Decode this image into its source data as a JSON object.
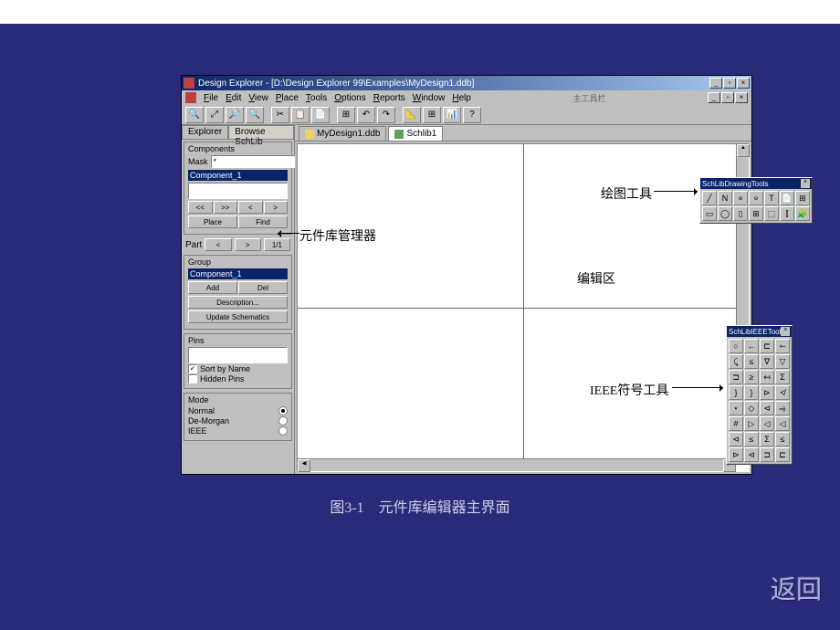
{
  "window": {
    "title": "Design Explorer - [D:\\Design Explorer 99\\Examples\\MyDesign1.ddb]",
    "min": "_",
    "max": "▫",
    "close": "×"
  },
  "menu": {
    "file": "File",
    "edit": "Edit",
    "view": "View",
    "place": "Place",
    "tools": "Tools",
    "options": "Options",
    "reports": "Reports",
    "window": "Window",
    "help": "Help",
    "extra": "主工具栏"
  },
  "left": {
    "tabs": {
      "explorer": "Explorer",
      "browse": "Browse SchLib"
    },
    "components": "Components",
    "mask": "Mask",
    "mask_value": "*",
    "selected": "Component_1",
    "nav": {
      "first": "<<",
      "prev": "<",
      "next": ">",
      "last": ">>"
    },
    "place": "Place",
    "find": "Find",
    "part": "Part",
    "part_prev": "<",
    "part_next": ">",
    "part_count": "1/1",
    "group": "Group",
    "group_selected": "Component_1",
    "add": "Add",
    "del": "Del",
    "description": "Description...",
    "update": "Update Schematics",
    "pins": "Pins",
    "sort_by_name": "Sort by Name",
    "hidden_pins": "Hidden Pins",
    "mode": "Mode",
    "normal": "Normal",
    "demorgan": "De-Morgan",
    "ieee": "IEEE"
  },
  "docs": {
    "tab1": "MyDesign1.ddb",
    "tab2": "Schlib1"
  },
  "palettes": {
    "drawing_title": "SchLibDrawingTools",
    "ieee_title": "SchLibIEEETool"
  },
  "annotations": {
    "drawing": "绘图工具",
    "editor": "编辑区",
    "components_mgr": "元件库管理器",
    "ieee": "IEEE符号工具"
  },
  "caption": "图3-1　元件库编辑器主界面",
  "return": "返回",
  "drawing_glyphs": [
    "╱",
    "N",
    "ဓ",
    "ဓ",
    "T",
    "📄",
    "⊞",
    "▭",
    "◯",
    "▯",
    "⊞",
    "⬚",
    "⫿",
    "🧩"
  ],
  "ieee_glyphs": [
    "○",
    "←",
    "⊏",
    "⇽",
    "⤹",
    "≤",
    "∇",
    "▽",
    "⊐",
    "≥",
    "↤",
    "Σ",
    "}",
    "}",
    "⊳",
    "≮",
    "⋆",
    "◇",
    "⊲",
    "⥤",
    "#",
    "▷",
    "◁",
    "◁",
    "⊲",
    "≤",
    "Σ",
    "≤",
    "⊳",
    "⊲",
    "⊐",
    "⊏"
  ]
}
